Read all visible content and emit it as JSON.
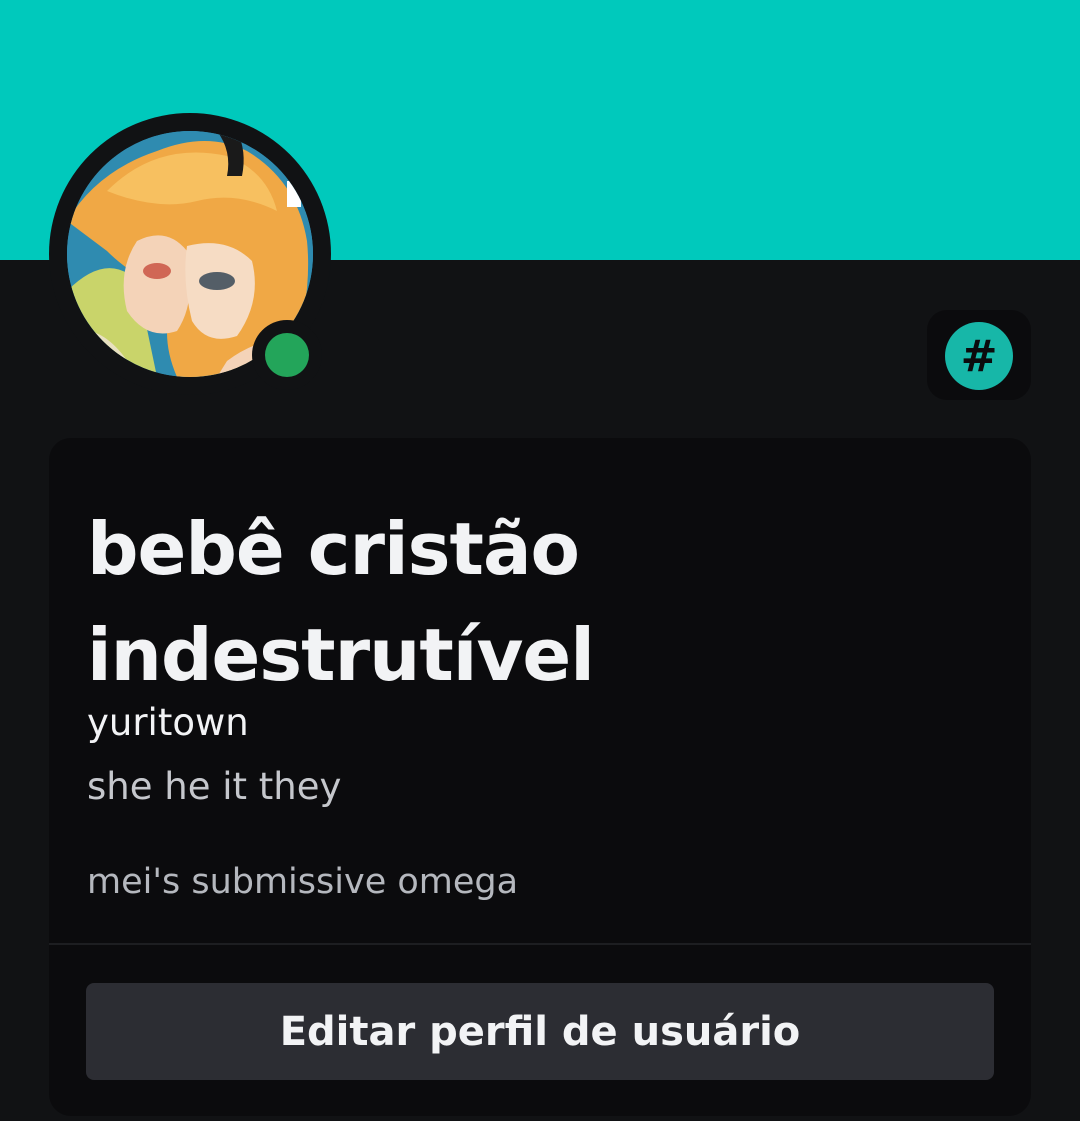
{
  "profile": {
    "display_name": "bebê cristão indestrutível",
    "username": "yuritown",
    "pronouns": "she he it they",
    "bio": "mei's submissive omega",
    "status": "online",
    "badge_symbol": "#"
  },
  "actions": {
    "edit_profile_label": "Editar perfil de usuário"
  },
  "colors": {
    "banner": "#00c9bc",
    "background": "#111214",
    "card": "#0b0b0d",
    "status_online": "#23a55a",
    "badge": "#17b7a8",
    "button": "#2c2d33"
  },
  "icons": {
    "status": "online-status-icon",
    "badge": "hashtag-badge-icon"
  }
}
